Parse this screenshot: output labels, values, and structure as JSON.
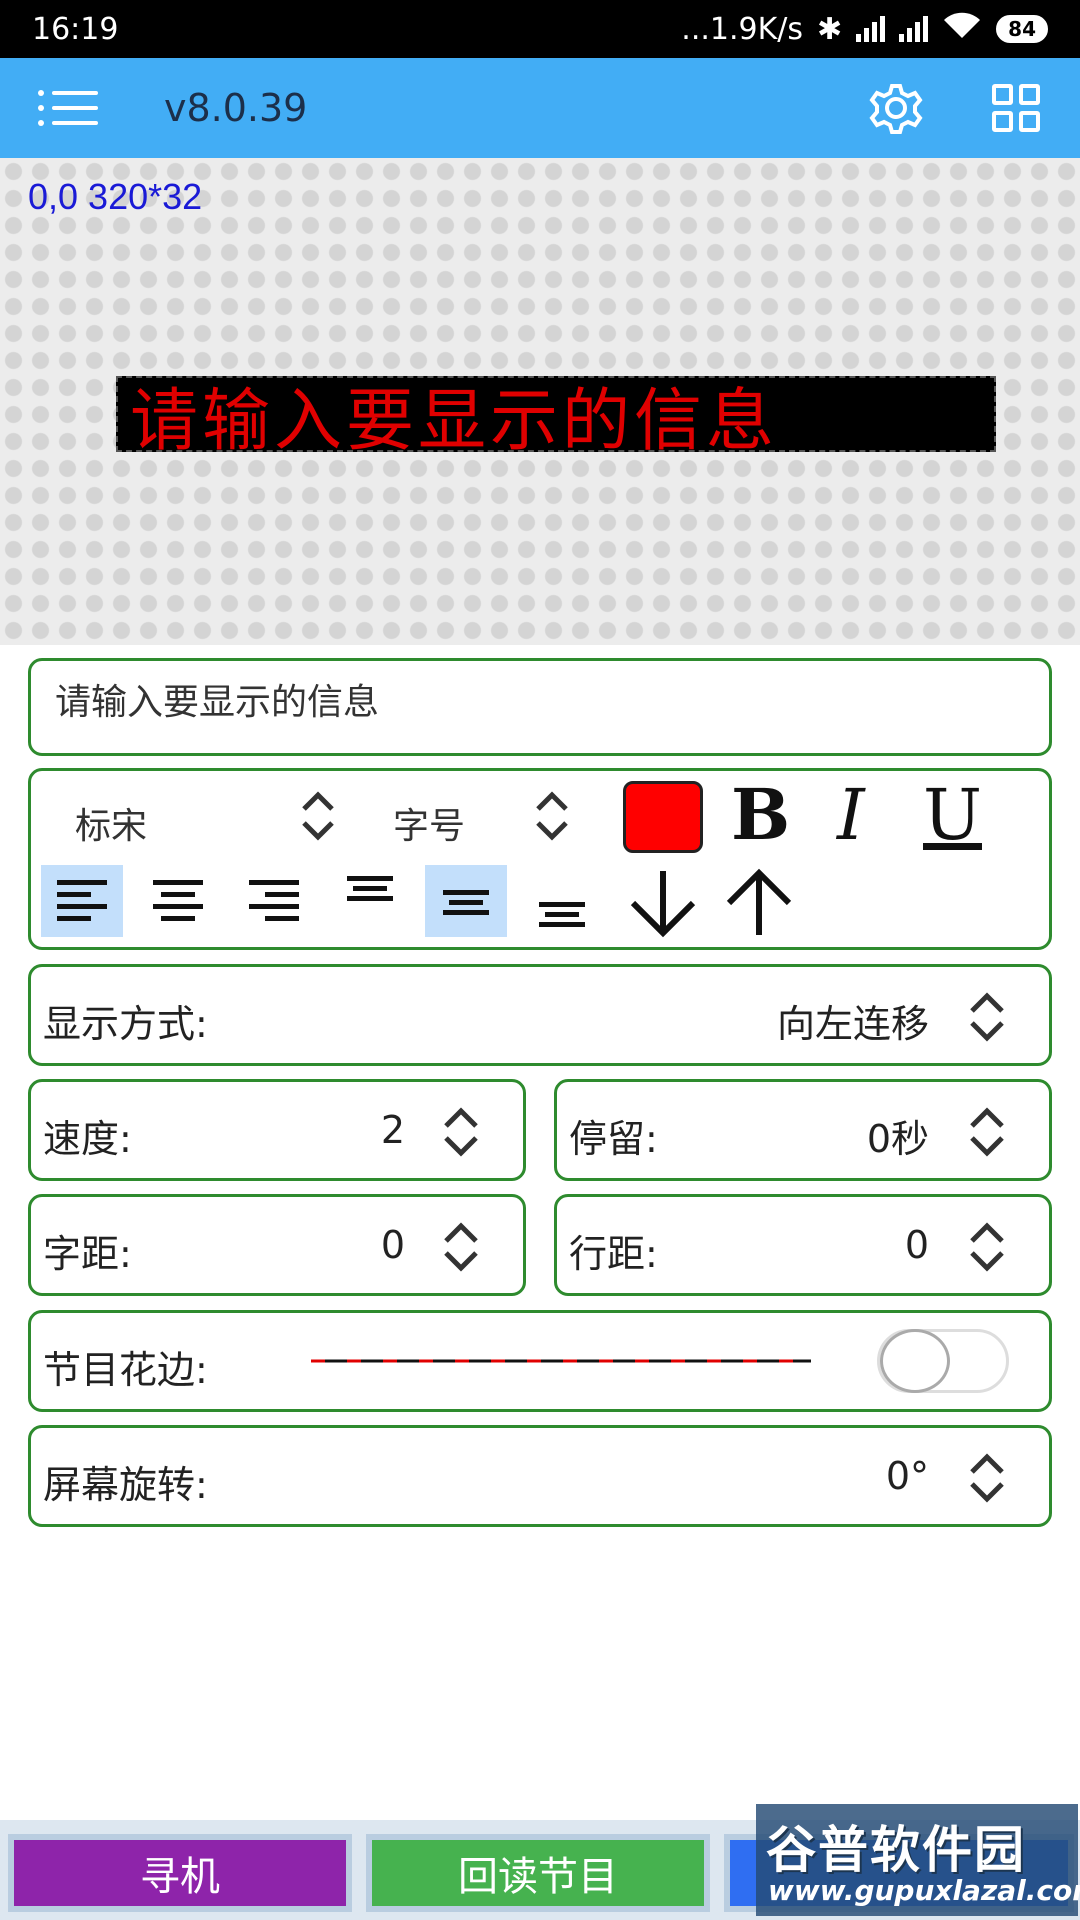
{
  "status_bar": {
    "time": "16:19",
    "speed": "...1.9K/s",
    "battery": "84"
  },
  "app_bar": {
    "version": "v8.0.39"
  },
  "preview": {
    "coords": "0,0 320*32",
    "led_text": "请输入要显示的信息",
    "led_color": "#e00000"
  },
  "text_input": {
    "value": "请输入要显示的信息"
  },
  "format": {
    "font": "标宋",
    "font_size": "字号",
    "text_color": "#ff0000",
    "bold": "B",
    "italic": "I",
    "underline": "U"
  },
  "display_mode": {
    "label": "显示方式:",
    "value": "向左连移"
  },
  "speed": {
    "label": "速度:",
    "value": "2"
  },
  "stay": {
    "label": "停留:",
    "value": "0秒"
  },
  "char_spacing": {
    "label": "字距:",
    "value": "0"
  },
  "line_spacing": {
    "label": "行距:",
    "value": "0"
  },
  "border": {
    "label": "节目花边:",
    "enabled": false
  },
  "rotation": {
    "label": "屏幕旋转:",
    "value": "0°"
  },
  "bottom": {
    "search": "寻机",
    "readback": "回读节目",
    "send": ""
  },
  "watermark": {
    "title": "谷普软件园",
    "url": "www.gupuxlazal.com"
  },
  "colors": {
    "accent": "#42adf5",
    "border": "#2e8b2e",
    "purple": "#8e24aa",
    "green": "#46b24f",
    "blue": "#2f6ef2"
  }
}
